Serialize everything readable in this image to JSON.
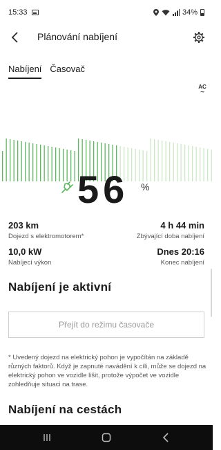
{
  "status_bar": {
    "time": "15:33",
    "battery": "34%"
  },
  "app_bar": {
    "title": "Plánování nabíjení"
  },
  "tabs": [
    {
      "label": "Nabíjení",
      "active": true
    },
    {
      "label": "Časovač",
      "active": false
    }
  ],
  "ac_badge": "AC",
  "charge": {
    "percent": "56",
    "unit": "%",
    "level_fraction": 0.56
  },
  "stats": {
    "range_value": "203 km",
    "range_label": "Dojezd s elektromotorem*",
    "remaining_value": "4 h 44 min",
    "remaining_label": "Zbývající doba nabíjení",
    "power_value": "10,0 kW",
    "power_label": "Nabíjecí výkon",
    "end_value": "Dnes 20:16",
    "end_label": "Konec nabíjení"
  },
  "status_heading": "Nabíjení je aktivní",
  "timer_button": "Přejít do režimu časovače",
  "footnote": "* Uvedený dojezd na elektrický pohon je vypočítán na základě různých faktorů. Když je zapnuté navádění k cíli, může se dojezd na elektrický pohon ve vozidle lišit, protože výpočet ve vozidle zohledňuje situaci na trase.",
  "travel_heading": "Nabíjení na cestách",
  "colors": {
    "accent_green": "#5cb85c",
    "light_green": "#cbe7c4",
    "text": "#1a1a1a",
    "nav_bar": "#0d0d0d"
  }
}
